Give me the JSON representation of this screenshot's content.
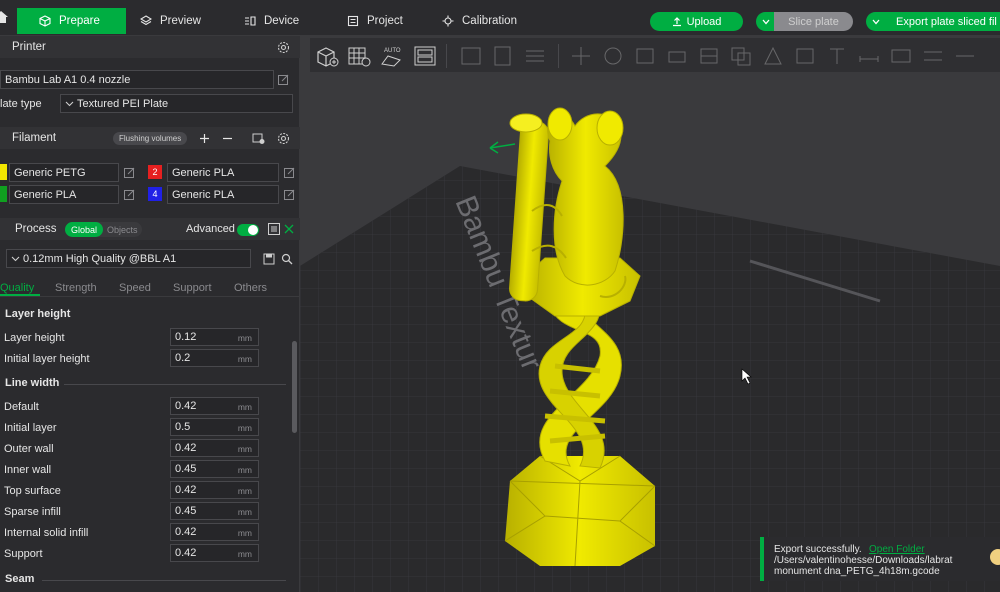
{
  "topbar": {
    "tabs": [
      {
        "label": "Prepare",
        "icon": "cube-icon",
        "active": true
      },
      {
        "label": "Preview",
        "icon": "layers-icon",
        "active": false
      },
      {
        "label": "Device",
        "icon": "device-icon",
        "active": false
      },
      {
        "label": "Project",
        "icon": "project-icon",
        "active": false
      },
      {
        "label": "Calibration",
        "icon": "calibration-icon",
        "active": false
      }
    ],
    "upload_label": "Upload",
    "slice_label": "Slice plate",
    "export_label": "Export plate sliced fil",
    "accent": "#00ae42"
  },
  "printer": {
    "title": "Printer",
    "name": "Bambu Lab A1 0.4 nozzle",
    "plate_type_label": "late type",
    "plate_type_value": "Textured PEI Plate"
  },
  "filament": {
    "title": "Filament",
    "flushing_label": "Flushing volumes",
    "items": [
      {
        "name": "Generic PETG",
        "color": "#f2e600",
        "slot": ""
      },
      {
        "name": "Generic PLA",
        "color": "#e62020",
        "slot": "2"
      },
      {
        "name": "Generic PLA",
        "color": "#10a020",
        "slot": ""
      },
      {
        "name": "Generic PLA",
        "color": "#2020e6",
        "slot": "4"
      }
    ]
  },
  "process": {
    "title": "Process",
    "global_label": "Global",
    "objects_label": "Objects",
    "advanced_label": "Advanced",
    "preset": "0.12mm High Quality @BBL A1",
    "tabs": [
      "Quality",
      "Strength",
      "Speed",
      "Support",
      "Others"
    ],
    "active_tab": "Quality",
    "groups": {
      "layer_height": {
        "title": "Layer height",
        "rows": [
          {
            "label": "Layer height",
            "value": "0.12",
            "unit": "mm"
          },
          {
            "label": "Initial layer height",
            "value": "0.2",
            "unit": "mm"
          }
        ]
      },
      "line_width": {
        "title": "Line width",
        "rows": [
          {
            "label": "Default",
            "value": "0.42",
            "unit": "mm"
          },
          {
            "label": "Initial layer",
            "value": "0.5",
            "unit": "mm"
          },
          {
            "label": "Outer wall",
            "value": "0.42",
            "unit": "mm"
          },
          {
            "label": "Inner wall",
            "value": "0.45",
            "unit": "mm"
          },
          {
            "label": "Top surface",
            "value": "0.42",
            "unit": "mm"
          },
          {
            "label": "Sparse infill",
            "value": "0.45",
            "unit": "mm"
          },
          {
            "label": "Internal solid infill",
            "value": "0.42",
            "unit": "mm"
          },
          {
            "label": "Support",
            "value": "0.42",
            "unit": "mm"
          }
        ]
      },
      "seam": {
        "title": "Seam"
      }
    }
  },
  "viewport": {
    "plate_text": "Bambu Textur",
    "model_color": "#f0ea00",
    "bed_color": "#2a2a2c"
  },
  "toast": {
    "message": "Export successfully.",
    "link": "Open Folder",
    "path": "/Users/valentinohesse/Downloads/labrat monument dna_PETG_4h18m.gcode"
  }
}
